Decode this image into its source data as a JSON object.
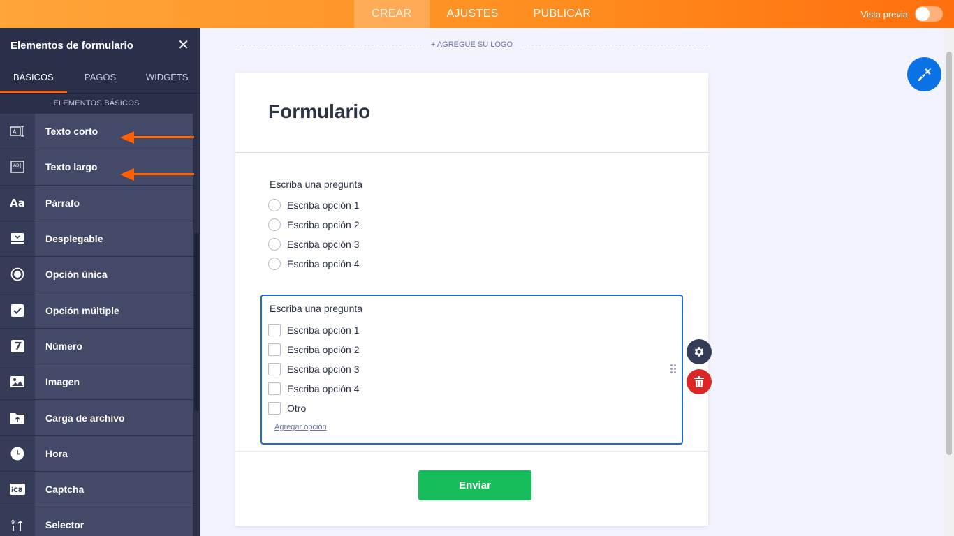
{
  "topbar": {
    "tabs": [
      {
        "label": "CREAR",
        "active": true
      },
      {
        "label": "AJUSTES",
        "active": false
      },
      {
        "label": "PUBLICAR",
        "active": false
      }
    ],
    "preview_label": "Vista previa",
    "preview_enabled": false
  },
  "sidebar": {
    "title": "Elementos de formulario",
    "close_icon": "close-icon",
    "tabs": [
      {
        "label": "BÁSICOS",
        "active": true
      },
      {
        "label": "PAGOS",
        "active": false
      },
      {
        "label": "WIDGETS",
        "active": false
      }
    ],
    "section_label": "ELEMENTOS BÁSICOS",
    "items": [
      {
        "label": "Texto corto",
        "icon": "short-text-icon"
      },
      {
        "label": "Texto largo",
        "icon": "long-text-icon"
      },
      {
        "label": "Párrafo",
        "icon": "paragraph-icon"
      },
      {
        "label": "Desplegable",
        "icon": "dropdown-icon"
      },
      {
        "label": "Opción única",
        "icon": "single-choice-icon"
      },
      {
        "label": "Opción múltiple",
        "icon": "multiple-choice-icon"
      },
      {
        "label": "Número",
        "icon": "number-icon"
      },
      {
        "label": "Imagen",
        "icon": "image-icon"
      },
      {
        "label": "Carga de archivo",
        "icon": "file-upload-icon"
      },
      {
        "label": "Hora",
        "icon": "clock-icon"
      },
      {
        "label": "Captcha",
        "icon": "captcha-icon"
      },
      {
        "label": "Selector",
        "icon": "selector-icon"
      }
    ]
  },
  "form": {
    "logo_placeholder": "+ AGREGUE SU LOGO",
    "title": "Formulario",
    "questions": [
      {
        "label": "Escriba una pregunta",
        "type": "radio",
        "options": [
          "Escriba opción 1",
          "Escriba opción 2",
          "Escriba opción 3",
          "Escriba opción 4"
        ]
      },
      {
        "label": "Escriba una pregunta",
        "type": "checkbox",
        "options": [
          "Escriba opción 1",
          "Escriba opción 2",
          "Escriba opción 3",
          "Escriba opción 4",
          "Otro"
        ],
        "add_option_label": "Agregar opción"
      }
    ],
    "submit_label": "Enviar"
  },
  "colors": {
    "accent": "#ff6100",
    "submit": "#18bd5b",
    "selected_border": "#1e6bd6",
    "delete": "#dc2626"
  }
}
